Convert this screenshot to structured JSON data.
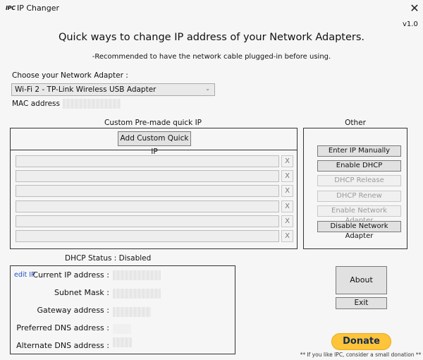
{
  "window": {
    "logo": "IPC",
    "title": "IP Changer",
    "close_glyph": "✕",
    "version": "v1.0"
  },
  "header": {
    "heading": "Quick ways to change IP address of your Network Adapters.",
    "subheading": "-Recommended to have the network cable plugged-in before using."
  },
  "adapter": {
    "label": "Choose your Network Adapter :",
    "selected": "Wi-Fi 2 - TP-Link Wireless USB Adapter",
    "chevron": "⌄",
    "mac_label": "MAC address :",
    "mac_value": ""
  },
  "custom": {
    "title": "Custom Pre-made quick IP",
    "add_label": "Add Custom Quick IP",
    "slots": [
      {
        "value": "",
        "remove_label": "X"
      },
      {
        "value": "",
        "remove_label": "X"
      },
      {
        "value": "",
        "remove_label": "X"
      },
      {
        "value": "",
        "remove_label": "X"
      },
      {
        "value": "",
        "remove_label": "X"
      },
      {
        "value": "",
        "remove_label": "X"
      }
    ]
  },
  "other": {
    "title": "Other",
    "buttons": [
      {
        "label": "Enter IP Manually",
        "enabled": true
      },
      {
        "label": "Enable DHCP",
        "enabled": true
      },
      {
        "label": "DHCP Release",
        "enabled": false
      },
      {
        "label": "DHCP Renew",
        "enabled": false
      },
      {
        "label": "Enable Network Adapter",
        "enabled": false
      },
      {
        "label": "Disable Network Adapter",
        "enabled": true
      }
    ]
  },
  "status": {
    "dhcp_label": "DHCP Status :",
    "dhcp_value": "Disabled"
  },
  "info": {
    "edit_ip": "edit IP",
    "rows": [
      {
        "label": "Current IP address :",
        "value": ""
      },
      {
        "label": "Subnet Mask :",
        "value": ""
      },
      {
        "label": "Gateway address :",
        "value": ""
      },
      {
        "label": "Preferred DNS address :",
        "value": ""
      },
      {
        "label": "Alternate DNS address :",
        "value": ""
      }
    ]
  },
  "actions": {
    "about": "About",
    "exit": "Exit",
    "donate": "Donate",
    "donate_note": "** If you like IPC, consider a small donation **"
  },
  "colors": {
    "background": "#f5f6f5",
    "link": "#2155c6",
    "donate": "#ffc439",
    "donate_text": "#142c52"
  }
}
